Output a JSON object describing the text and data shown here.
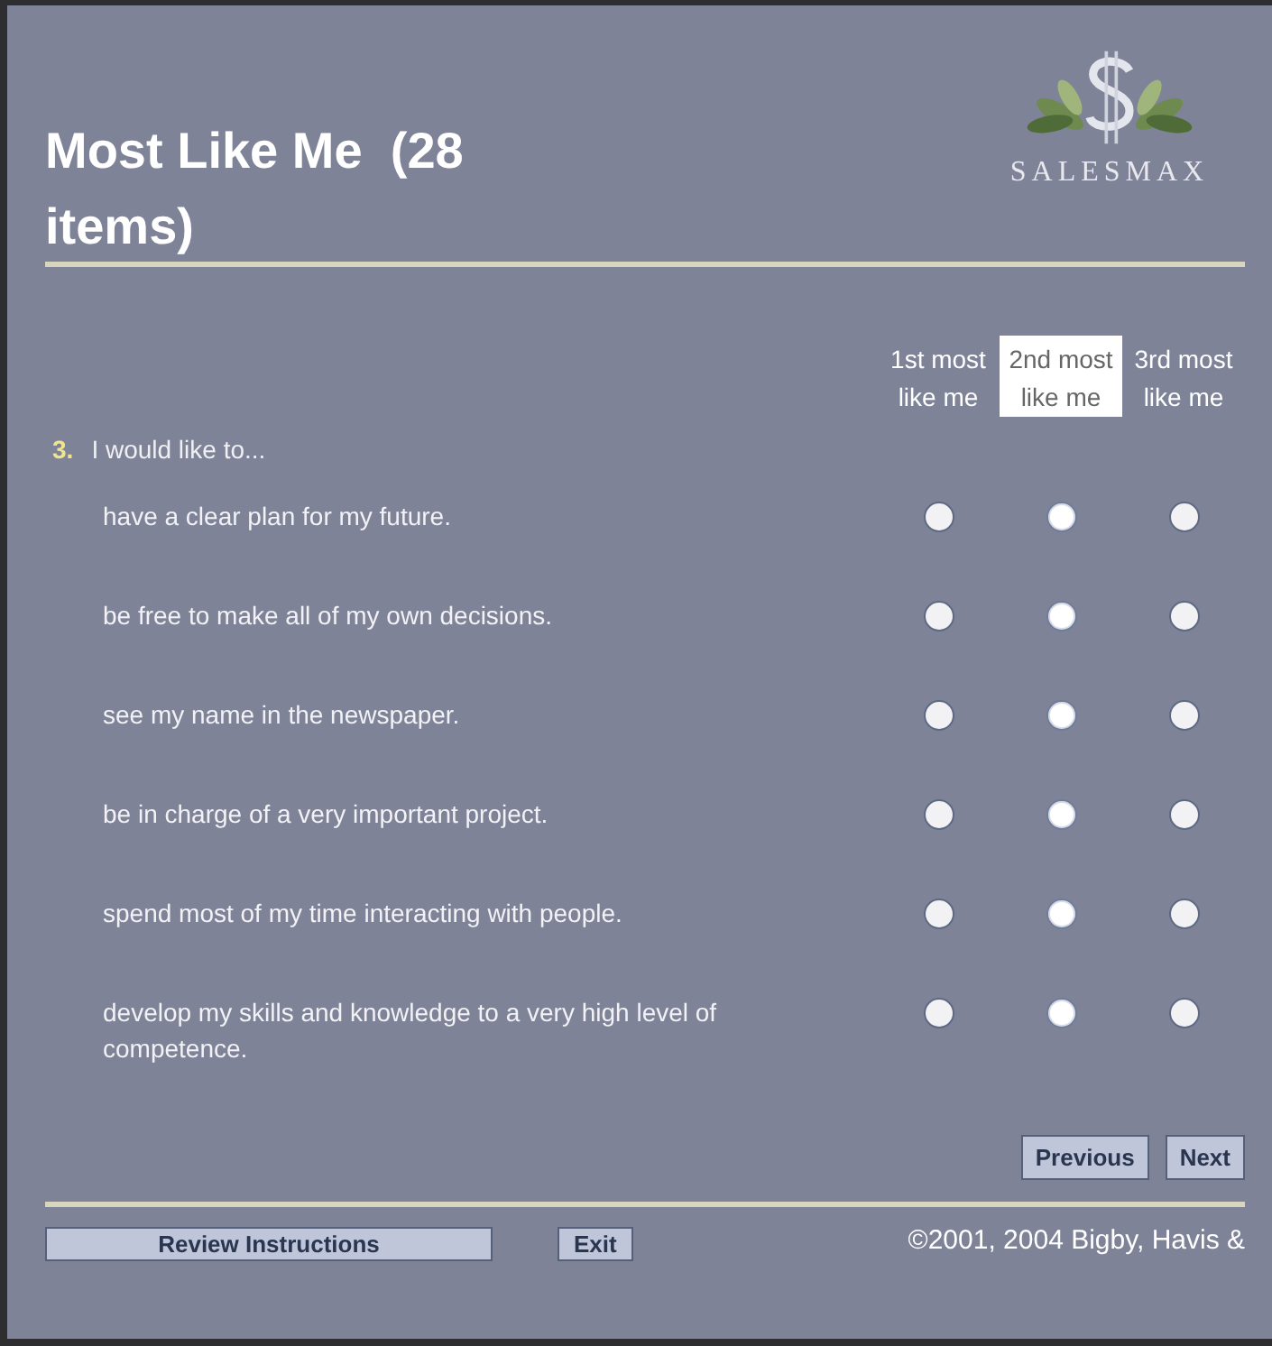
{
  "title": "Most Like Me  (28 items)",
  "logo": {
    "text": "SALESMAX"
  },
  "columns": [
    {
      "label": "1st most like me",
      "highlighted": false
    },
    {
      "label": "2nd most like me",
      "highlighted": true
    },
    {
      "label": "3rd most like me",
      "highlighted": false
    }
  ],
  "question": {
    "number": "3.",
    "text": "I would like to..."
  },
  "rows": [
    {
      "text": "have a clear plan for my future.",
      "choices": [
        {
          "selected": false
        },
        {
          "selected": false
        },
        {
          "selected": false
        }
      ]
    },
    {
      "text": "be free to make all of my own decisions.",
      "choices": [
        {
          "selected": false
        },
        {
          "selected": false
        },
        {
          "selected": false
        }
      ]
    },
    {
      "text": "see my name in the newspaper.",
      "choices": [
        {
          "selected": false
        },
        {
          "selected": false
        },
        {
          "selected": false
        }
      ]
    },
    {
      "text": "be in charge of a very important project.",
      "choices": [
        {
          "selected": false
        },
        {
          "selected": false
        },
        {
          "selected": false
        }
      ]
    },
    {
      "text": "spend most of my time interacting with people.",
      "choices": [
        {
          "selected": false
        },
        {
          "selected": false
        },
        {
          "selected": false
        }
      ]
    },
    {
      "text": "develop my skills and knowledge to a very high level of competence.",
      "choices": [
        {
          "selected": false
        },
        {
          "selected": false
        },
        {
          "selected": false
        }
      ]
    }
  ],
  "nav_buttons": [
    "Previous",
    "Next"
  ],
  "footer_buttons": [
    "Review Instructions",
    "Exit"
  ],
  "copyright": "©2001, 2004 Bigby, Havis &"
}
